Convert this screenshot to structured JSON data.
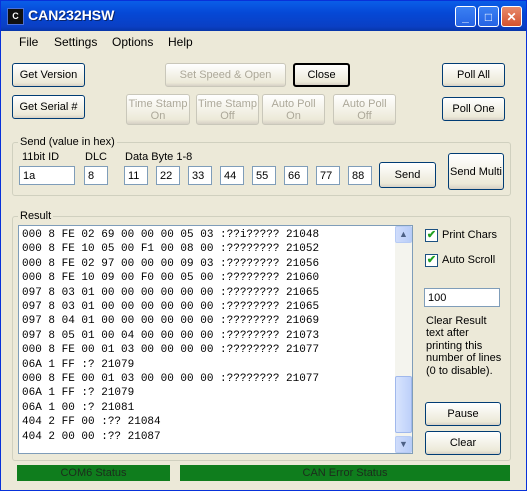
{
  "window": {
    "title": "CAN232HSW",
    "icon_letter": "C",
    "controls": {
      "minimize": "_",
      "maximize": "□",
      "close": "✕"
    }
  },
  "menu": [
    "File",
    "Settings",
    "Options",
    "Help"
  ],
  "buttons": {
    "get_version": "Get Version",
    "get_serial": "Get Serial #",
    "set_speed_open": "Set Speed & Open",
    "close": "Close",
    "poll_all": "Poll All",
    "poll_one": "Poll One",
    "timestamp_on": "Time Stamp On",
    "timestamp_off": "Time Stamp Off",
    "auto_poll_on": "Auto Poll On",
    "auto_poll_off": "Auto Poll Off"
  },
  "send": {
    "group_label": "Send (value in hex)",
    "id_label": "11bit ID",
    "dlc_label": "DLC",
    "data_label": "Data Byte 1-8",
    "id_value": "1a",
    "dlc_value": "8",
    "data_bytes": [
      "11",
      "22",
      "33",
      "44",
      "55",
      "66",
      "77",
      "88"
    ],
    "send_button": "Send",
    "send_multi_button": "Send Multi"
  },
  "result": {
    "group_label": "Result",
    "lines": [
      "000 8 FE 02 69 00 00 00 05 03 :??i????? 21048",
      "000 8 FE 10 05 00 F1 00 08 00 :???????? 21052",
      "000 8 FE 02 97 00 00 00 09 03 :???????? 21056",
      "000 8 FE 10 09 00 F0 00 05 00 :???????? 21060",
      "097 8 03 01 00 00 00 00 00 00 :???????? 21065",
      "097 8 03 01 00 00 00 00 00 00 :???????? 21065",
      "097 8 04 01 00 00 00 00 00 00 :???????? 21069",
      "097 8 05 01 00 04 00 00 00 00 :???????? 21073",
      "000 8 FE 00 01 03 00 00 00 00 :???????? 21077",
      "06A 1 FF :? 21079",
      "000 8 FE 00 01 03 00 00 00 00 :???????? 21077",
      "06A 1 FF :? 21079",
      "06A 1 00 :? 21081",
      "404 2 FF 00 :?? 21084",
      "404 2 00 00 :?? 21087"
    ],
    "print_chars_label": "Print Chars",
    "print_chars_checked": true,
    "auto_scroll_label": "Auto Scroll",
    "auto_scroll_checked": true,
    "clear_lines_value": "100",
    "clear_help": "Clear Result text after printing this number of lines (0 to disable).",
    "pause_button": "Pause",
    "clear_button": "Clear"
  },
  "status": {
    "com_status": "COM6 Status",
    "can_error_status": "CAN Error Status",
    "indicator_color": "#0f7d1d"
  }
}
